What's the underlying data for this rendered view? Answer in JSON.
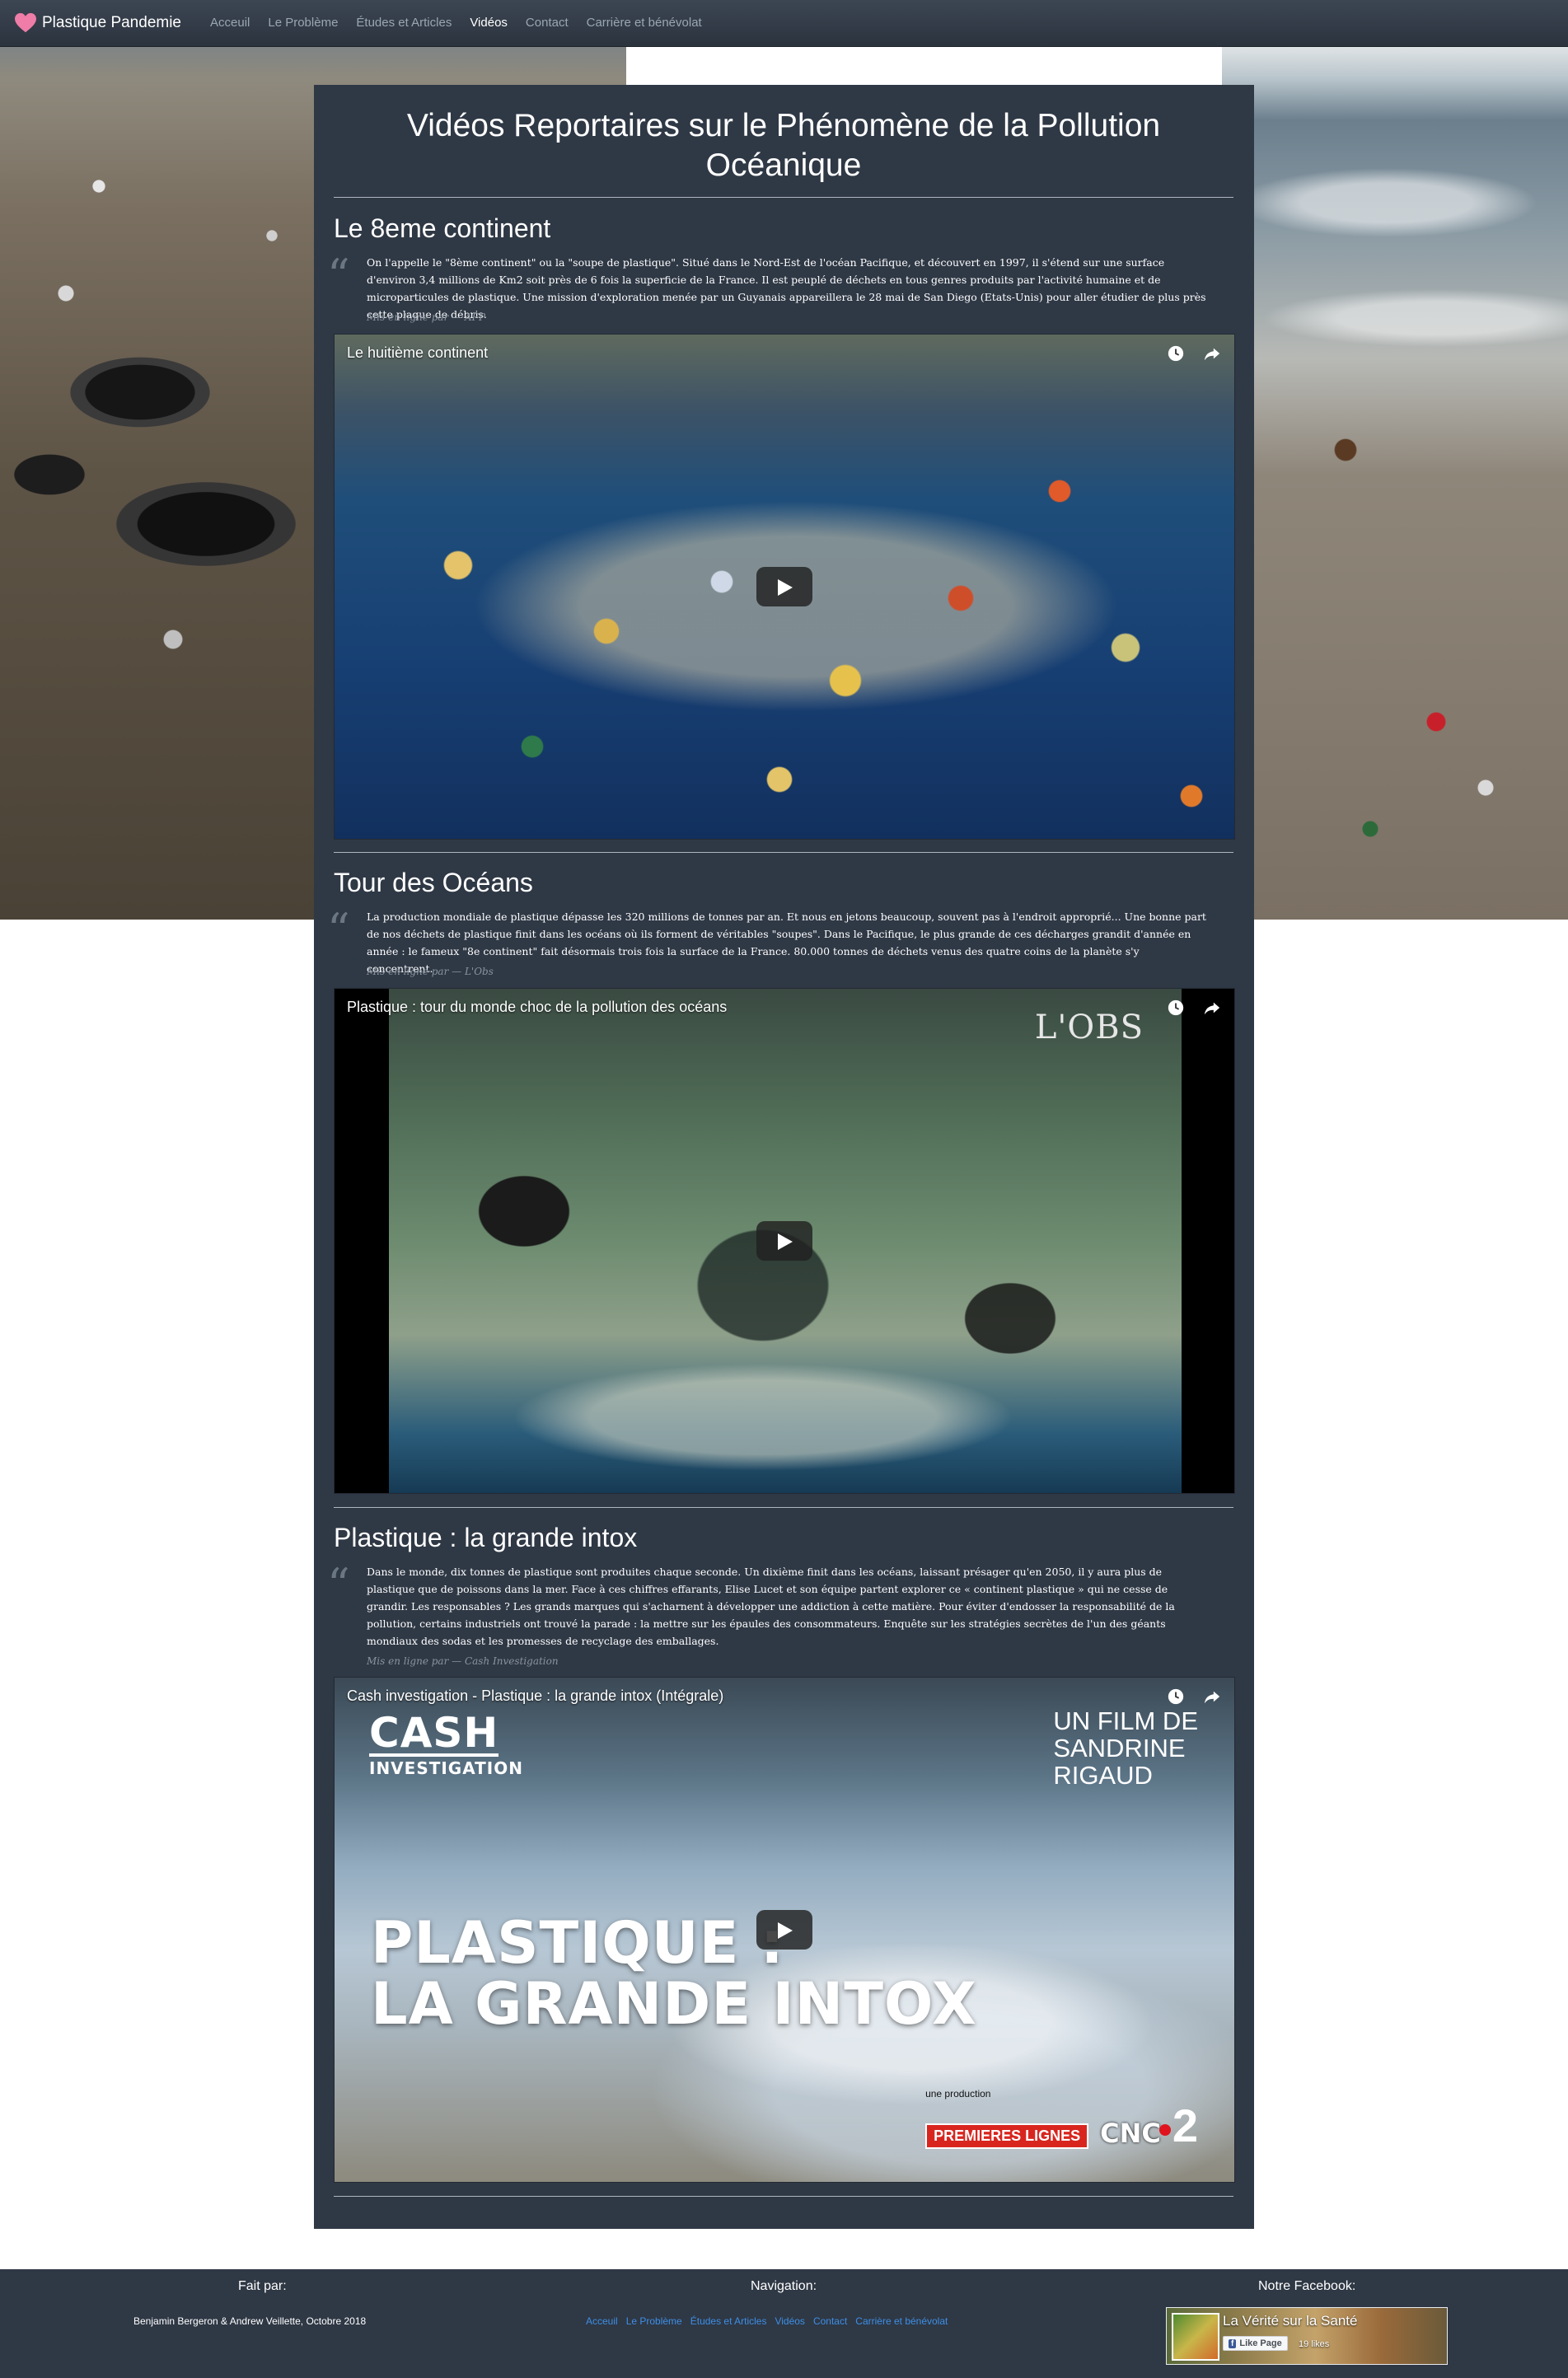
{
  "nav": {
    "brand": "Plastique Pandemie",
    "brand_icon": "heart-icon",
    "links": [
      "Acceuil",
      "Le Problème",
      "Études et Articles",
      "Vidéos",
      "Contact",
      "Carrière et bénévolat"
    ],
    "active": "Vidéos"
  },
  "page": {
    "title": "Vidéos Reportaires sur le Phénomène de la Pollution Océanique"
  },
  "sections": [
    {
      "title": "Le 8eme continent",
      "quote": "On l'appelle le \"8ème continent\" ou la \"soupe de plastique\". Situé dans le Nord-Est de l'océan Pacifique, et découvert en 1997, il s'étend sur une surface d'environ 3,4 millions de Km2 soit près de 6 fois la superficie de la France. Il est peuplé de déchets en tous genres produits par l'activité humaine et de microparticules de plastique. Une mission d'exploration menée par un Guyanais appareillera le 28 mai de San Diego (Etats-Unis) pour aller étudier de plus près cette plaque de débris.",
      "source": "Mis en ligne par — AFP",
      "video_title": "Le huitième continent"
    },
    {
      "title": "Tour des Océans",
      "quote": "La production mondiale de plastique dépasse les 320 millions de tonnes par an. Et nous en jetons beaucoup, souvent pas à l'endroit approprié... Une bonne part de nos déchets de plastique finit dans les océans où ils forment de véritables \"soupes\". Dans le Pacifique, le plus grande de ces décharges grandit d'année en année : le fameux \"8e continent\" fait désormais trois fois la surface de la France. 80.000 tonnes de déchets venus des quatre coins de la planète s'y concentrent.",
      "source": "Mis en ligne par — L'Obs",
      "video_title": "Plastique : tour du monde choc de la pollution des océans",
      "overlay_logo": "L'OBS"
    },
    {
      "title": "Plastique : la grande intox",
      "quote": "Dans le monde, dix tonnes de plastique sont produites chaque seconde. Un dixième finit dans les océans, laissant présager qu'en 2050, il y aura plus de plastique que de poissons dans la mer. Face à ces chiffres effarants, Elise Lucet et son équipe partent explorer ce « continent plastique » qui ne cesse de grandir. Les responsables ? Les grands marques qui s'acharnent à développer une addiction à cette matière. Pour éviter d'endosser la responsabilité de la pollution, certains industriels ont trouvé la parade : la mettre sur les épaules des consommateurs. Enquête sur les stratégies secrètes de l'un des géants mondiaux des sodas et les promesses de recyclage des emballages.",
      "source": "Mis en ligne par — Cash Investigation",
      "video_title": "Cash investigation - Plastique : la grande intox (Intégrale)",
      "poster": {
        "logo_line1": "CASH",
        "logo_line2": "INVESTIGATION",
        "film_line1": "UN FILM DE",
        "film_line2": "SANDRINE",
        "film_line3": "RIGAUD",
        "big_line1": "PLASTIQUE :",
        "big_line2": "LA GRANDE INTOX",
        "prod_label": "une production",
        "prod_company": "PREMIERES LIGNES",
        "cnc": "CNC",
        "channel": "2"
      }
    }
  ],
  "footer": {
    "made_by_title": "Fait par:",
    "made_by_text": "Benjamin Bergeron & Andrew Veillette, Octobre 2018",
    "nav_title": "Navigation:",
    "nav_links": [
      "Acceuil",
      "Le Problème",
      "Études et Articles",
      "Vidéos",
      "Contact",
      "Carrière et bénévolat"
    ],
    "facebook_title": "Notre Facebook:",
    "facebook_page": "La Vérité sur la Santé",
    "like_label": "Like Page",
    "likes": "19 likes"
  },
  "colors": {
    "panel": "#2f3845",
    "navbar": "#343d48",
    "footer_link": "#3d8fe6",
    "heart": "#f07ca8"
  }
}
